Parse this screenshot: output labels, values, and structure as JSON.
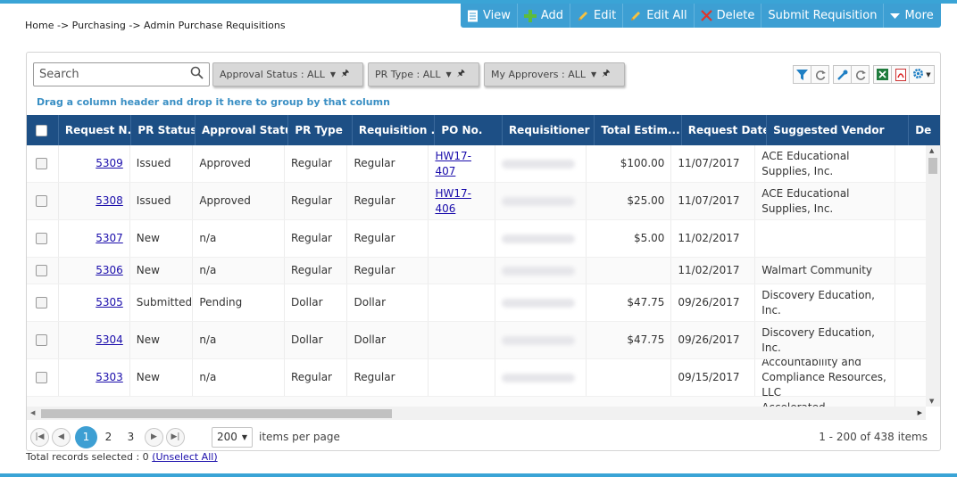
{
  "breadcrumb": "Home -> Purchasing -> Admin Purchase Requisitions",
  "toolbar": {
    "view": "View",
    "add": "Add",
    "edit": "Edit",
    "edit_all": "Edit All",
    "delete": "Delete",
    "submit": "Submit Requisition",
    "more": "More"
  },
  "search": {
    "placeholder": "Search"
  },
  "filters": {
    "approval_status": "Approval Status : ALL",
    "pr_type": "PR Type : ALL",
    "my_approvers": "My Approvers : ALL"
  },
  "group_hint": "Drag a column header and drop it here to group by that column",
  "columns": {
    "request_no": "Request N...",
    "pr_status": "PR Status",
    "approval_status": "Approval Status",
    "pr_type": "PR Type",
    "requisition": "Requisition ...",
    "po_no": "PO No.",
    "requisitioner": "Requisitioner",
    "total_est": "Total Estim...",
    "request_date": "Request Date",
    "vendor": "Suggested Vendor",
    "desc": "De"
  },
  "rows": [
    {
      "request_no": "5309",
      "pr_status": "Issued",
      "approval_status": "Approved",
      "pr_type": "Regular",
      "requisition": "Regular",
      "po_no": "HW17-407",
      "total": "$100.00",
      "date": "11/07/2017",
      "vendor": "ACE Educational Supplies, Inc."
    },
    {
      "request_no": "5308",
      "pr_status": "Issued",
      "approval_status": "Approved",
      "pr_type": "Regular",
      "requisition": "Regular",
      "po_no": "HW17-406",
      "total": "$25.00",
      "date": "11/07/2017",
      "vendor": "ACE Educational Supplies, Inc."
    },
    {
      "request_no": "5307",
      "pr_status": "New",
      "approval_status": "n/a",
      "pr_type": "Regular",
      "requisition": "Regular",
      "po_no": "",
      "total": "$5.00",
      "date": "11/02/2017",
      "vendor": ""
    },
    {
      "request_no": "5306",
      "pr_status": "New",
      "approval_status": "n/a",
      "pr_type": "Regular",
      "requisition": "Regular",
      "po_no": "",
      "total": "",
      "date": "11/02/2017",
      "vendor": "Walmart Community"
    },
    {
      "request_no": "5305",
      "pr_status": "Submitted",
      "approval_status": "Pending",
      "pr_type": "Dollar",
      "requisition": "Dollar",
      "po_no": "",
      "total": "$47.75",
      "date": "09/26/2017",
      "vendor": "Discovery Education, Inc."
    },
    {
      "request_no": "5304",
      "pr_status": "New",
      "approval_status": "n/a",
      "pr_type": "Dollar",
      "requisition": "Dollar",
      "po_no": "",
      "total": "$47.75",
      "date": "09/26/2017",
      "vendor": "Discovery Education, Inc."
    },
    {
      "request_no": "5303",
      "pr_status": "New",
      "approval_status": "n/a",
      "pr_type": "Regular",
      "requisition": "Regular",
      "po_no": "",
      "total": "",
      "date": "09/15/2017",
      "vendor": "Accountability and Compliance Resources, LLC"
    },
    {
      "request_no": "",
      "pr_status": "",
      "approval_status": "",
      "pr_type": "",
      "requisition": "",
      "po_no": "",
      "total": "",
      "date": "",
      "vendor": "Accelerated Construction"
    }
  ],
  "pager": {
    "pages": [
      "1",
      "2",
      "3"
    ],
    "current_page": "1",
    "per_page": "200",
    "per_page_label": "items per page",
    "info": "1 - 200 of 438 items"
  },
  "footer": {
    "total_selected": "Total records selected : 0",
    "unselect_all": "(Unselect All)"
  },
  "colors": {
    "accent": "#3d9fd3",
    "header": "#1d4f85",
    "link": "#1a0dab"
  }
}
